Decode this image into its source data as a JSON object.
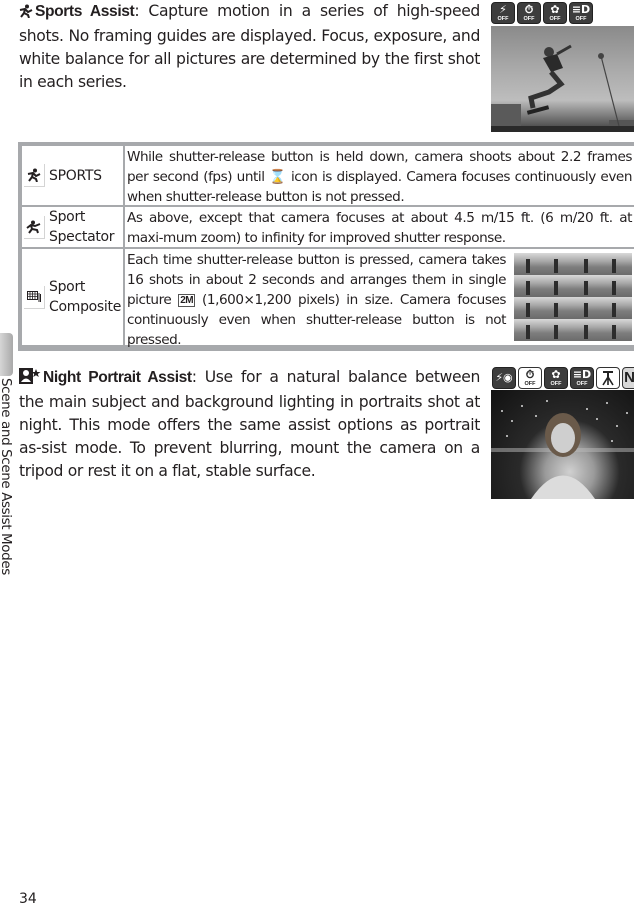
{
  "side_tab": {
    "label": "Scene and Scene Assist Modes"
  },
  "page_number": "34",
  "sports_assist": {
    "mode_icon": "sports-icon",
    "title": "Sports Assist",
    "body_lines": [
      ": Capture motion in a series of high-speed shots.",
      "No framing guides are displayed.  Focus, exposure, and white",
      "balance for all pictures are determined by the first shot in each",
      "series."
    ],
    "icons": [
      {
        "name": "flash-icon",
        "glyph": "⚡",
        "status": "OFF",
        "style": "dark"
      },
      {
        "name": "self-timer-icon",
        "glyph": "⏱",
        "status": "OFF",
        "style": "dark"
      },
      {
        "name": "macro-icon",
        "glyph": "✿",
        "status": "OFF",
        "style": "dark"
      },
      {
        "name": "af-assist-icon",
        "glyph": "≡D",
        "status": "OFF",
        "style": "dark"
      }
    ],
    "photo_alt": "Skateboarder mid-air"
  },
  "sports_table": {
    "rows": [
      {
        "icon": "sports-icon",
        "glyph": "🏃",
        "name": "SPORTS",
        "description": "While shutter-release button is held down, camera shoots about 2.2 frames per second (fps) until ",
        "description_icon": "⌛",
        "description_tail": " icon is displayed.  Camera focuses continuously even when shutter-release button is not pressed."
      },
      {
        "icon": "sport-spectator-icon",
        "glyph": "🏃",
        "name": "Sport Spectator",
        "description": "As above, except that camera focuses at about 4.5 m/15 ft. (6 m/20 ft. at maxi-mum zoom) to infinity for improved shutter response."
      },
      {
        "icon": "sport-composite-icon",
        "glyph": "▦",
        "name": "Sport Composite",
        "description": "Each time shutter-release button is pressed, camera takes 16 shots in about 2 seconds and arranges them in single picture ",
        "description_icon": "2M",
        "description_tail": " (1,600×1,200 pixels) in size.  Camera focuses continuously even when shutter-release button is not pressed."
      }
    ]
  },
  "night_portrait_assist": {
    "mode_icon": "night-portrait-icon",
    "title": "Night Portrait Assist",
    "body": ": Use for a natural balance between the main subject and background lighting in portraits shot at night.  This mode offers the same assist options as portrait as-sist mode.  To prevent blurring, mount the camera on a tripod or rest it on a flat, stable surface.",
    "icons": [
      {
        "name": "red-eye-flash-icon",
        "glyph": "⚡◉",
        "status": "",
        "style": "dark"
      },
      {
        "name": "self-timer-icon",
        "glyph": "⏱",
        "status": "OFF",
        "style": "light"
      },
      {
        "name": "macro-icon",
        "glyph": "✿",
        "status": "OFF",
        "style": "dark"
      },
      {
        "name": "af-assist-icon",
        "glyph": "≡D",
        "status": "OFF",
        "style": "dark"
      },
      {
        "name": "tripod-icon",
        "glyph": "⊼",
        "status": "",
        "style": "light"
      },
      {
        "name": "noise-reduction-icon",
        "glyph": "NR",
        "status": "",
        "style": "gray"
      }
    ],
    "photo_alt": "Woman portrait at night with city lights"
  }
}
